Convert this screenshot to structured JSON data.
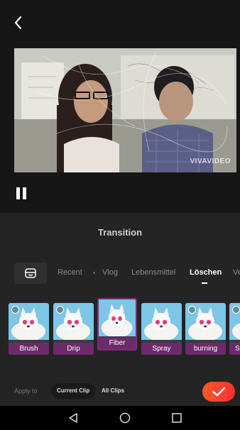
{
  "preview": {
    "watermark": "VIVAVIDEO"
  },
  "panel": {
    "title": "Transition"
  },
  "tabs": [
    {
      "label": "Recent",
      "active": false
    },
    {
      "label": "Vlog",
      "active": false
    },
    {
      "label": "Lebensmittel",
      "active": false
    },
    {
      "label": "Löschen",
      "active": true
    },
    {
      "label": "Ve",
      "active": false
    }
  ],
  "transitions": [
    {
      "label": "Brush",
      "selected": false
    },
    {
      "label": "Drip",
      "selected": false
    },
    {
      "label": "Fiber",
      "selected": true
    },
    {
      "label": "Spray",
      "selected": false
    },
    {
      "label": "burning",
      "selected": false
    },
    {
      "label": "S",
      "selected": false
    }
  ],
  "apply": {
    "label": "Apply to",
    "current_clip": "Current Clip",
    "all_clips": "All Clips"
  },
  "colors": {
    "accent": "#ff3b2f",
    "selected_border": "#7d2e79",
    "label_bg": "#6d2a6b"
  }
}
